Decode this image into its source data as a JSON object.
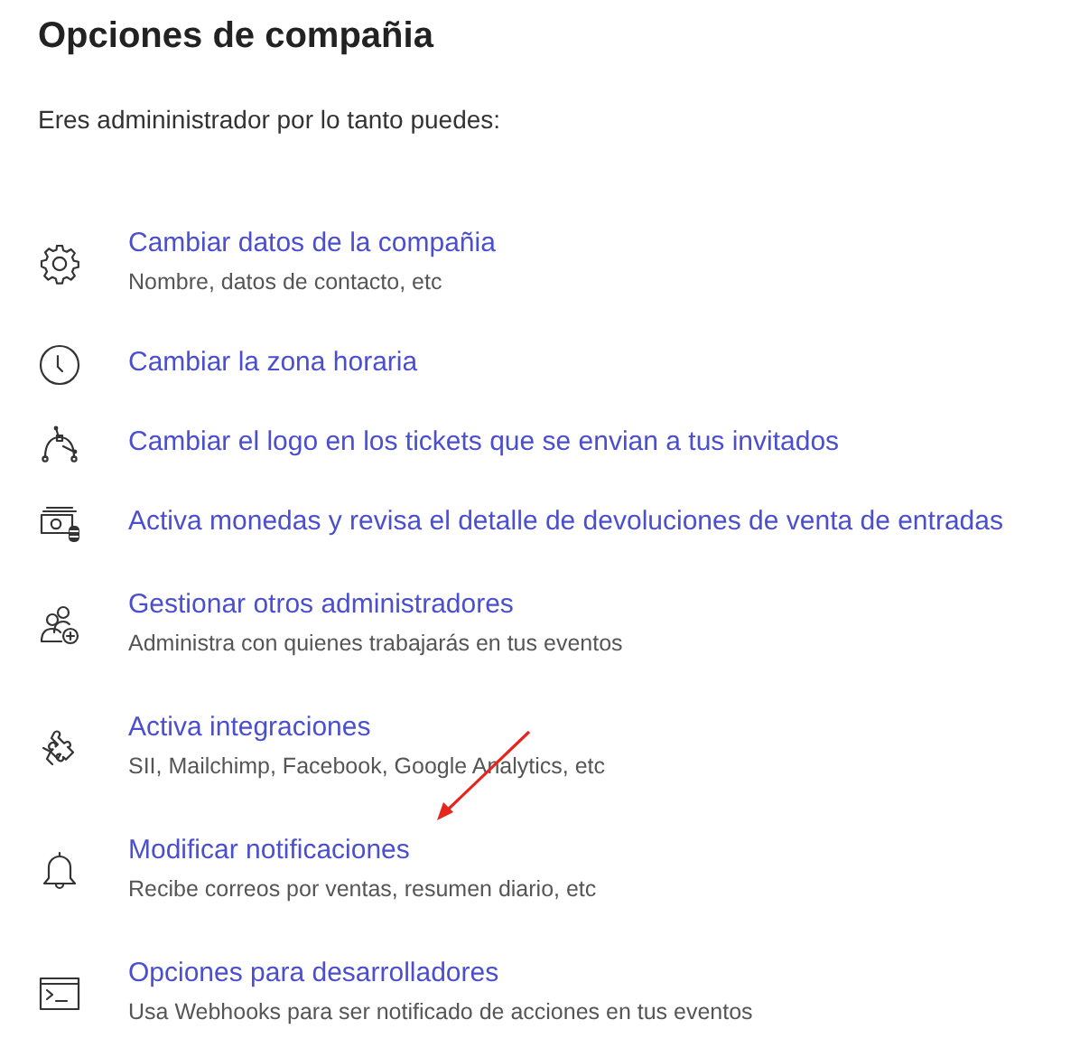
{
  "title": "Opciones de compañia",
  "intro": "Eres admininistrador por lo tanto puedes:",
  "items": [
    {
      "kind": "gear",
      "label": "Cambiar datos de la compañia",
      "description": "Nombre, datos de contacto, etc",
      "annotated": false
    },
    {
      "kind": "clock",
      "label": "Cambiar la zona horaria",
      "annotated": false
    },
    {
      "kind": "pen",
      "label": "Cambiar el logo en los tickets que se envian a tus invitados",
      "annotated": false
    },
    {
      "kind": "money",
      "label": "Activa monedas y revisa el detalle de devoluciones de venta de entradas",
      "annotated": false
    },
    {
      "kind": "users",
      "label": "Gestionar otros administradores",
      "description": "Administra con quienes trabajarás en tus eventos",
      "annotated": false
    },
    {
      "kind": "puzzle",
      "label": "Activa integraciones",
      "description": "SII, Mailchimp, Facebook, Google Analytics, etc",
      "annotated": false
    },
    {
      "kind": "bell",
      "label": "Modificar notificaciones",
      "description": "Recibe correos por ventas, resumen diario, etc",
      "annotated": true
    },
    {
      "kind": "terminal",
      "label": "Opciones para desarrolladores",
      "description": "Usa Webhooks para ser notificado de acciones en tus eventos",
      "annotated": false
    }
  ]
}
